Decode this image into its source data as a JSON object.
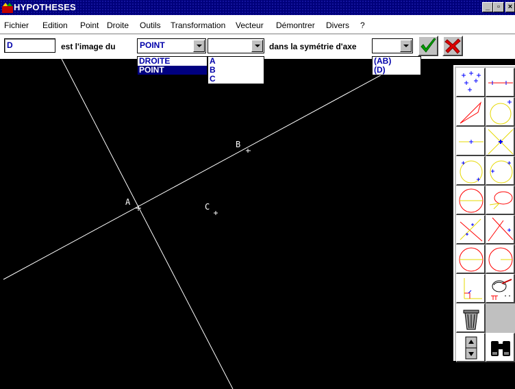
{
  "window": {
    "title": "HYPOTHESES"
  },
  "menu": [
    "Fichier",
    "Edition",
    "Point",
    "Droite",
    "Outils",
    "Transformation",
    "Vecteur",
    "Démontrer",
    "Divers",
    "?"
  ],
  "toolbar": {
    "image_name": "D",
    "label_image_of": "est l'image du",
    "object_type_value": "POINT",
    "object_type_options": [
      "DROITE",
      "POINT"
    ],
    "object_type_selected": "POINT",
    "object_name_value": "",
    "object_name_options": [
      "A",
      "B",
      "C"
    ],
    "label_symmetry": "dans la symétrie d'axe",
    "axis_value": "",
    "axis_options": [
      "(AB)",
      "(D)"
    ]
  },
  "canvas": {
    "points": [
      {
        "label": "A"
      },
      {
        "label": "B"
      },
      {
        "label": "C"
      }
    ]
  },
  "palette": {
    "tools": [
      "points-tool-icon",
      "point-on-line-tool-icon",
      "triangle-tool-icon",
      "circle-tool-icon",
      "midpoint-tool-icon",
      "intersection-tool-icon",
      "circle-points-tool-icon",
      "circle-point-tool-icon",
      "circle-diameter-tool-icon",
      "ellipse-tool-icon",
      "bisector-tool-icon",
      "cross-lines-tool-icon",
      "circle-chord-tool-icon",
      "circle-radius-tool-icon",
      "right-angle-tool-icon",
      "measure-tool-icon",
      "trash-icon",
      "scroll-icon",
      "binoculars-icon"
    ]
  },
  "colors": {
    "titlebar": "#00007b",
    "select_text": "#0000aa",
    "tool_red": "#ff0000",
    "tool_yellow": "#e6d800",
    "tool_blue": "#0000ff",
    "check_green": "#00a000",
    "cancel_red": "#e00000"
  }
}
